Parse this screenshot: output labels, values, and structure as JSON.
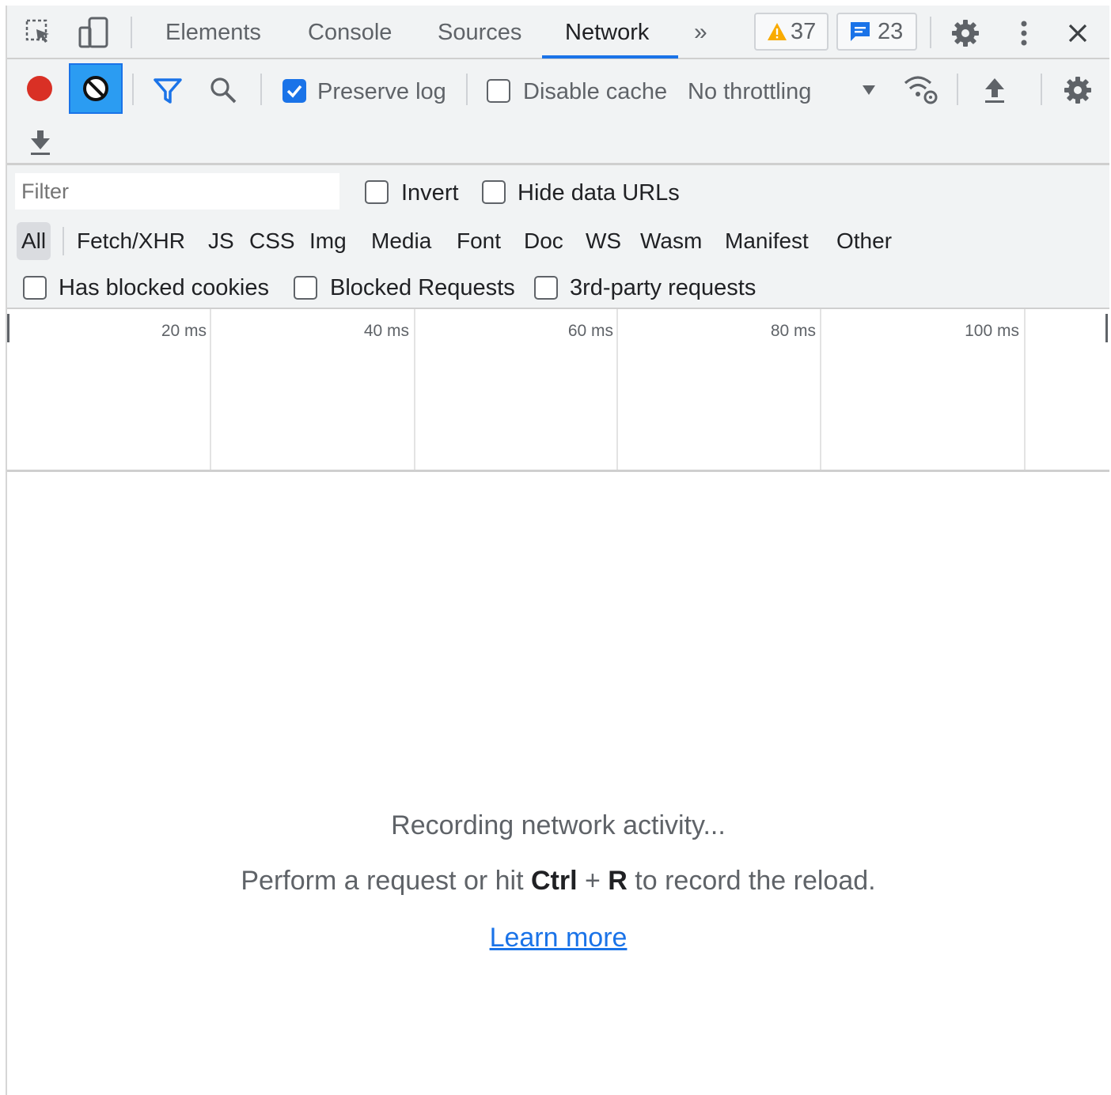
{
  "tabs": {
    "items": [
      "Elements",
      "Console",
      "Sources",
      "Network"
    ],
    "more": "»",
    "warnings_count": "37",
    "messages_count": "23"
  },
  "toolbar": {
    "preserve_log": "Preserve log",
    "disable_cache": "Disable cache",
    "throttling": "No throttling"
  },
  "filters": {
    "placeholder": "Filter",
    "invert": "Invert",
    "hide_data_urls": "Hide data URLs",
    "types": [
      "All",
      "Fetch/XHR",
      "JS",
      "CSS",
      "Img",
      "Media",
      "Font",
      "Doc",
      "WS",
      "Wasm",
      "Manifest",
      "Other"
    ],
    "has_blocked_cookies": "Has blocked cookies",
    "blocked_requests": "Blocked Requests",
    "third_party": "3rd-party requests"
  },
  "timeline": {
    "ticks": [
      "20 ms",
      "40 ms",
      "60 ms",
      "80 ms",
      "100 ms"
    ]
  },
  "empty_state": {
    "line1": "Recording network activity...",
    "line2_prefix": "Perform a request or hit ",
    "line2_key1": "Ctrl",
    "line2_plus": " + ",
    "line2_key2": "R",
    "line2_suffix": " to record the reload.",
    "learn_more": "Learn more"
  },
  "colors": {
    "accent": "#1a73e8",
    "record": "#d93025",
    "warning": "#f9ab00",
    "panel": "#f1f3f4"
  },
  "icons": {
    "inspect": "inspect-element-icon",
    "device": "device-toolbar-icon",
    "record": "record-icon",
    "clear": "clear-icon",
    "filter": "filter-icon",
    "search": "search-icon",
    "network_conditions": "network-conditions-icon",
    "import": "import-har-icon",
    "export": "export-har-icon",
    "settings": "gear-icon",
    "menu": "kebab-menu-icon",
    "close": "close-icon"
  }
}
